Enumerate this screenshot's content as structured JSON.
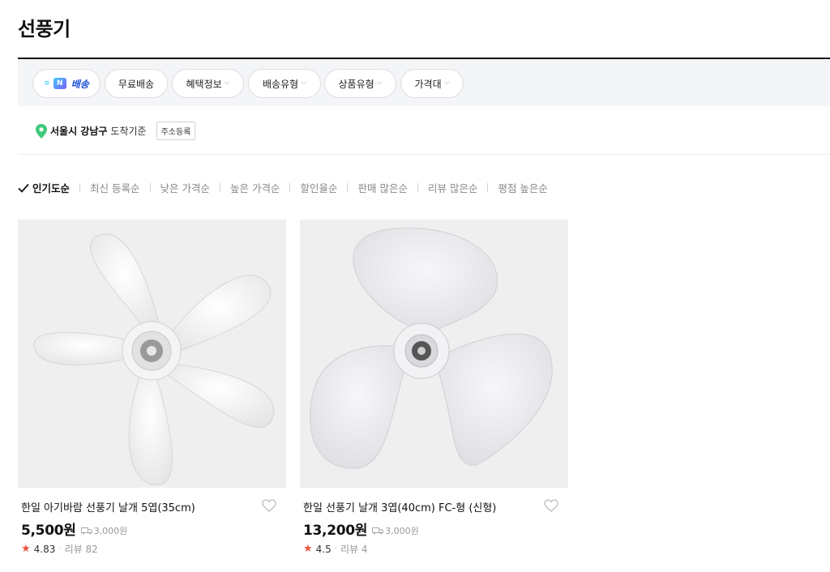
{
  "page": {
    "title": "선풍기"
  },
  "filters": [
    {
      "label": "배송",
      "type": "n-delivery"
    },
    {
      "label": "무료배송",
      "dropdown": false
    },
    {
      "label": "혜택정보",
      "dropdown": true
    },
    {
      "label": "배송유형",
      "dropdown": true
    },
    {
      "label": "상품유형",
      "dropdown": true
    },
    {
      "label": "가격대",
      "dropdown": true
    }
  ],
  "location": {
    "area": "서울시 강남구",
    "suffix": "도착기준",
    "button": "주소등록"
  },
  "sort": {
    "active": "인기도순",
    "options": [
      "최신 등록순",
      "낮은 가격순",
      "높은 가격순",
      "할인율순",
      "판매 많은순",
      "리뷰 많은순",
      "평점 높은순"
    ]
  },
  "products": [
    {
      "title": "한일 아기바람 선풍기 날개 5엽(35cm)",
      "price": "5,500원",
      "shipping": "3,000원",
      "rating": "4.83",
      "reviews": "리뷰 82"
    },
    {
      "title": "한일 선풍기 날개 3엽(40cm) FC-형 (신형)",
      "price": "13,200원",
      "shipping": "3,000원",
      "rating": "4.5",
      "reviews": "리뷰 4"
    }
  ],
  "colors": {
    "accent_star": "#f0533c",
    "ndelivery_blue": "#1d4fd6",
    "pin_green": "#3ec97b"
  }
}
